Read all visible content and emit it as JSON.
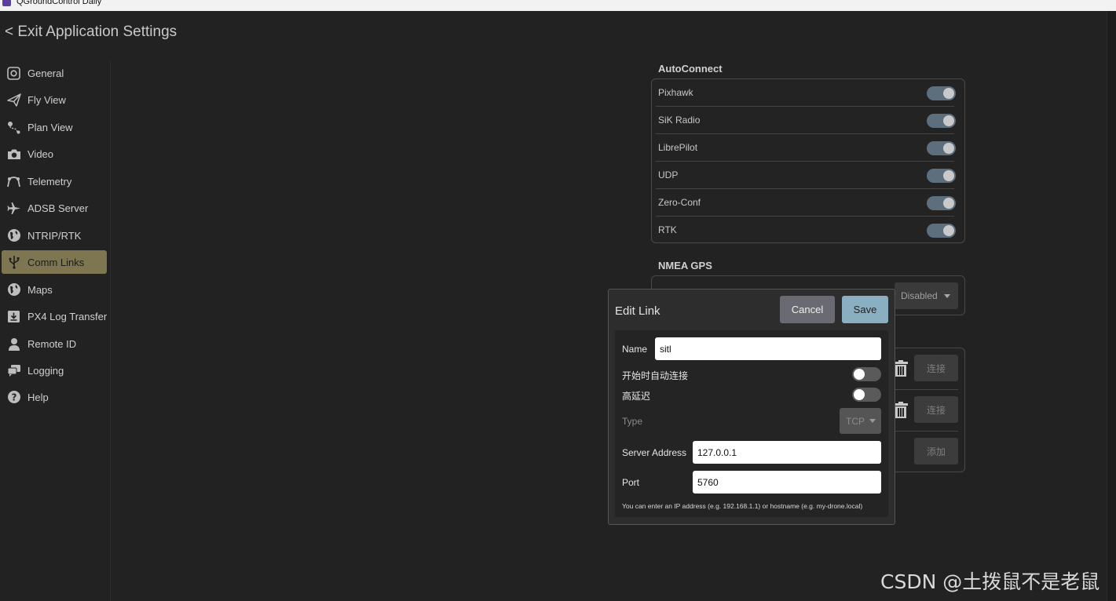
{
  "window": {
    "title": "QGroundControl Daily",
    "icon": "qgc-app-icon"
  },
  "header": {
    "exit_label": "< Exit Application Settings"
  },
  "sidebar": {
    "items": [
      {
        "label": "General",
        "icon": "general-icon",
        "active": false
      },
      {
        "label": "Fly View",
        "icon": "paper-plane-icon",
        "active": false
      },
      {
        "label": "Plan View",
        "icon": "waypoint-path-icon",
        "active": false
      },
      {
        "label": "Video",
        "icon": "camera-icon",
        "active": false
      },
      {
        "label": "Telemetry",
        "icon": "telemetry-icon",
        "active": false
      },
      {
        "label": "ADSB Server",
        "icon": "airplane-icon",
        "active": false
      },
      {
        "label": "NTRIP/RTK",
        "icon": "globe-icon",
        "active": false
      },
      {
        "label": "Comm Links",
        "icon": "usb-icon",
        "active": true
      },
      {
        "label": "Maps",
        "icon": "globe-icon",
        "active": false
      },
      {
        "label": "PX4 Log Transfer",
        "icon": "download-icon",
        "active": false
      },
      {
        "label": "Remote ID",
        "icon": "person-icon",
        "active": false
      },
      {
        "label": "Logging",
        "icon": "chat-bubbles-icon",
        "active": false
      },
      {
        "label": "Help",
        "icon": "question-icon",
        "active": false
      }
    ]
  },
  "autoconnect": {
    "title": "AutoConnect",
    "items": [
      {
        "label": "Pixhawk",
        "enabled": true
      },
      {
        "label": "SiK Radio",
        "enabled": true
      },
      {
        "label": "LibrePilot",
        "enabled": true
      },
      {
        "label": "UDP",
        "enabled": true
      },
      {
        "label": "Zero-Conf",
        "enabled": true
      },
      {
        "label": "RTK",
        "enabled": true
      }
    ]
  },
  "nmea": {
    "title": "NMEA GPS",
    "dropdown_value": "Disabled"
  },
  "links": {
    "connect_label": "连接",
    "add_label": "添加"
  },
  "edit_link": {
    "title": "Edit Link",
    "cancel_label": "Cancel",
    "save_label": "Save",
    "name_label": "Name",
    "name_value": "sitl",
    "auto_connect_label": "开始时自动连接",
    "auto_connect_enabled": false,
    "high_latency_label": "高延迟",
    "high_latency_enabled": false,
    "type_label": "Type",
    "type_value": "TCP",
    "server_address_label": "Server Address",
    "server_address_value": "127.0.0.1",
    "port_label": "Port",
    "port_value": "5760",
    "hint": "You can enter an IP address (e.g. 192.168.1.1) or hostname (e.g. my-drone.local)"
  },
  "watermark": "CSDN @土拨鼠不是老鼠",
  "colors": {
    "accent_active": "#7d7651",
    "save_button": "#8aafc1",
    "background": "#222222"
  }
}
